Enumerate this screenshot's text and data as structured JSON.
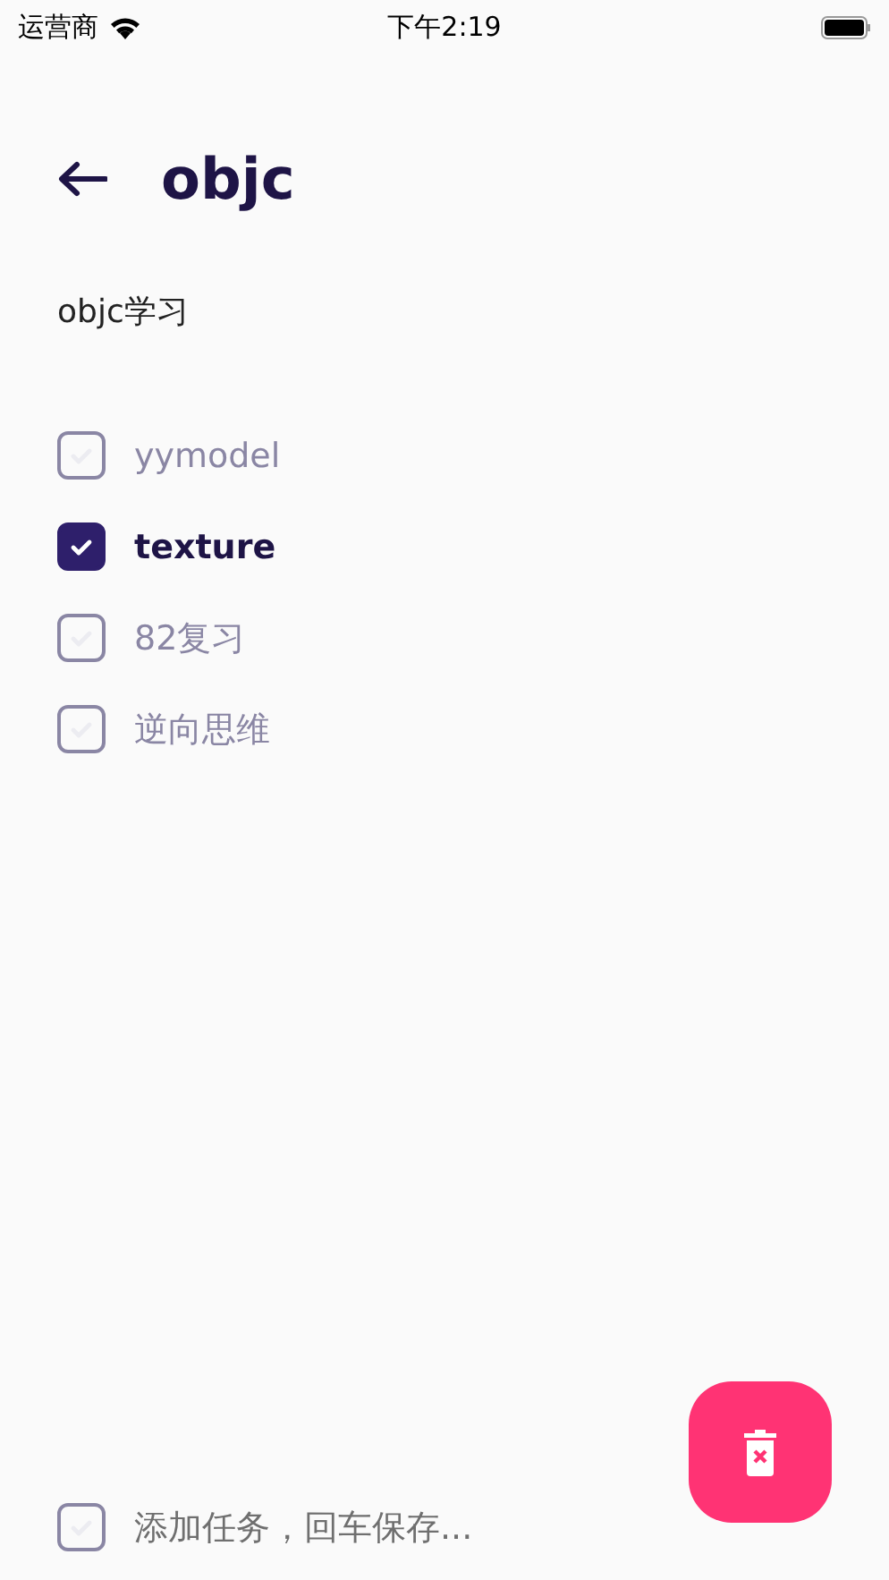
{
  "status_bar": {
    "carrier": "运营商",
    "time": "下午2:19"
  },
  "header": {
    "title": "objc"
  },
  "description": "objc学习",
  "tasks": [
    {
      "label": "yymodel",
      "checked": false
    },
    {
      "label": "texture",
      "checked": true
    },
    {
      "label": "82复习",
      "checked": false
    },
    {
      "label": "逆向思维",
      "checked": false
    }
  ],
  "new_task": {
    "placeholder": "添加任务，回车保存...",
    "checked": false
  }
}
